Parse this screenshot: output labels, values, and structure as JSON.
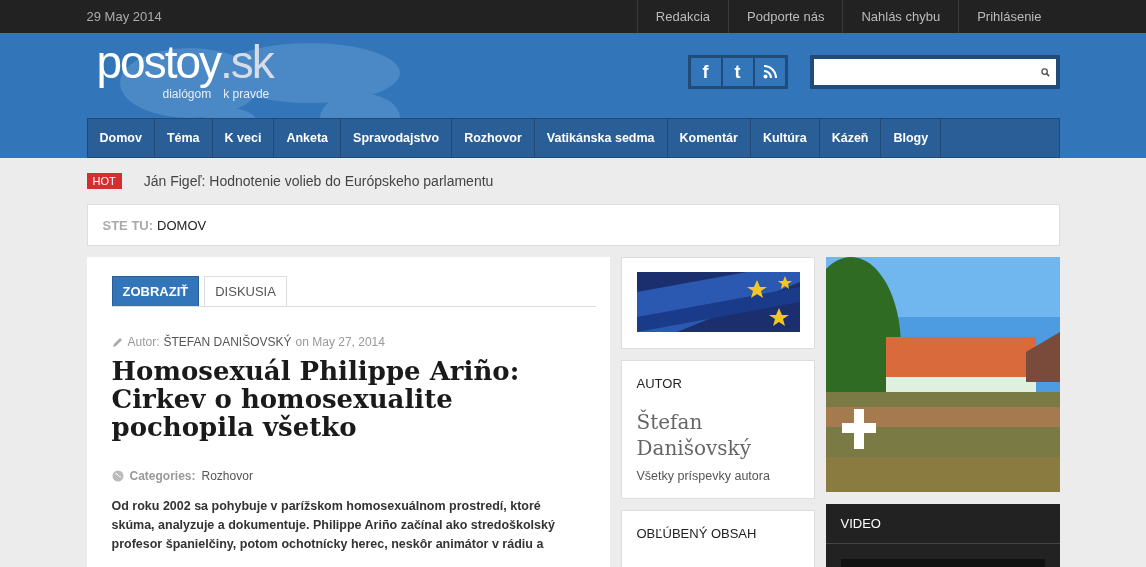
{
  "top_bar": {
    "date": "29 May 2014",
    "links": [
      "Redakcia",
      "Podporte nás",
      "Nahlás chybu",
      "Prihlásenie"
    ]
  },
  "logo": {
    "name": "postoy",
    "domain": ".sk",
    "tagline_1": "dialógom",
    "tagline_2": "k pravde"
  },
  "social": [
    {
      "kind": "glyph",
      "glyph": "f"
    },
    {
      "kind": "glyph",
      "glyph": "t"
    },
    {
      "kind": "rss"
    }
  ],
  "nav": [
    "Domov",
    "Téma",
    "K veci",
    "Anketa",
    "Spravodajstvo",
    "Rozhovor",
    "Vatikánska sedma",
    "Komentár",
    "Kultúra",
    "Kázeň",
    "Blogy"
  ],
  "hot": {
    "badge": "HOT",
    "headline": "Ján Figeľ: Hodnotenie volieb do Európskeho parlamentu"
  },
  "breadcrumb": {
    "label": "STE TU:",
    "current": "DOMOV"
  },
  "tabs": [
    {
      "label": "ZOBRAZIŤ",
      "selected": true
    },
    {
      "label": "DISKUSIA",
      "selected": false
    }
  ],
  "article": {
    "author_label": "Autor:",
    "author": "ŠTEFAN DANIŠOVSKÝ",
    "date": "on May 27, 2014",
    "title": "Homosexuál Philippe Ariño: Cirkev o homosexualite pochopila všetko",
    "categories_label": "Categories:",
    "category": "Rozhovor",
    "lead": "Od roku 2002 sa pohybuje v parížskom homosexuálnom prostredí, ktoré skúma, analyzuje a dokumentuje. Philippe Ariño začínal ako stredoškolský profesor španielčiny, potom ochotnícky herec, neskôr animátor v rádiu a"
  },
  "author_box": {
    "heading": "AUTOR",
    "name": "Štefan Danišovský",
    "link": "Všetky príspevky autora"
  },
  "popular": {
    "heading": "OBĽÚBENÝ OBSAH"
  },
  "video": {
    "heading": "VIDEO"
  }
}
